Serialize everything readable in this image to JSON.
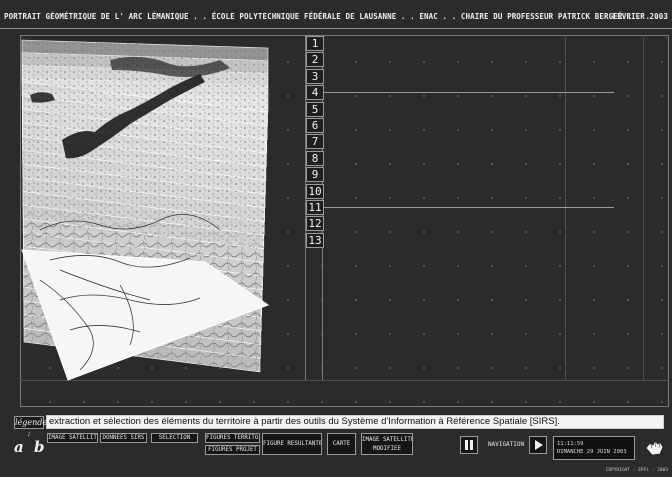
{
  "header": {
    "title": "PORTRAIT GÉOMÉTRIQUE DE L' ARC LÉMANIQUE . . ÉCOLE POLYTECHNIQUE FÉDÉRALE DE LAUSANNE . . ENAC . . CHAIRE DU PROFESSEUR PATRICK BERGER . . . . . . . . . .",
    "date": "FÉVRIER 2003"
  },
  "layers": [
    "1",
    "2",
    "3",
    "4",
    "5",
    "6",
    "7",
    "8",
    "9",
    "10",
    "11",
    "12",
    "13"
  ],
  "highlighted_layers": [
    "4",
    "11"
  ],
  "legend": {
    "label": "légende :",
    "text": "extraction et sélection des éléments du territoire à partir des outils du Système d'Information à Référence Spatiale [SIRS]."
  },
  "nav": {
    "a": "a",
    "b": "b",
    "buttons": {
      "image_satellite": "IMAGE SATELLITE",
      "donnees_sirs": "DONNEES SIRS",
      "selection": "SELECTION",
      "figures_territoire": "FIGURES TERRITOIRE",
      "figures_projet": "FIGURES PROJET",
      "figure_resultante": "FIGURE RESULTANTE",
      "carte": "CARTE",
      "image_satellite_modifiee_1": "IMAGE SATELLITE",
      "image_satellite_modifiee_2": "MODIFIEE"
    },
    "navigation_label": "NAVIGATION"
  },
  "clock": {
    "time": "11:11:59",
    "date": "DIMANCHE 29 JUIN 2003"
  },
  "copyright": "COPYRIGHT : EPFL : 2003"
}
